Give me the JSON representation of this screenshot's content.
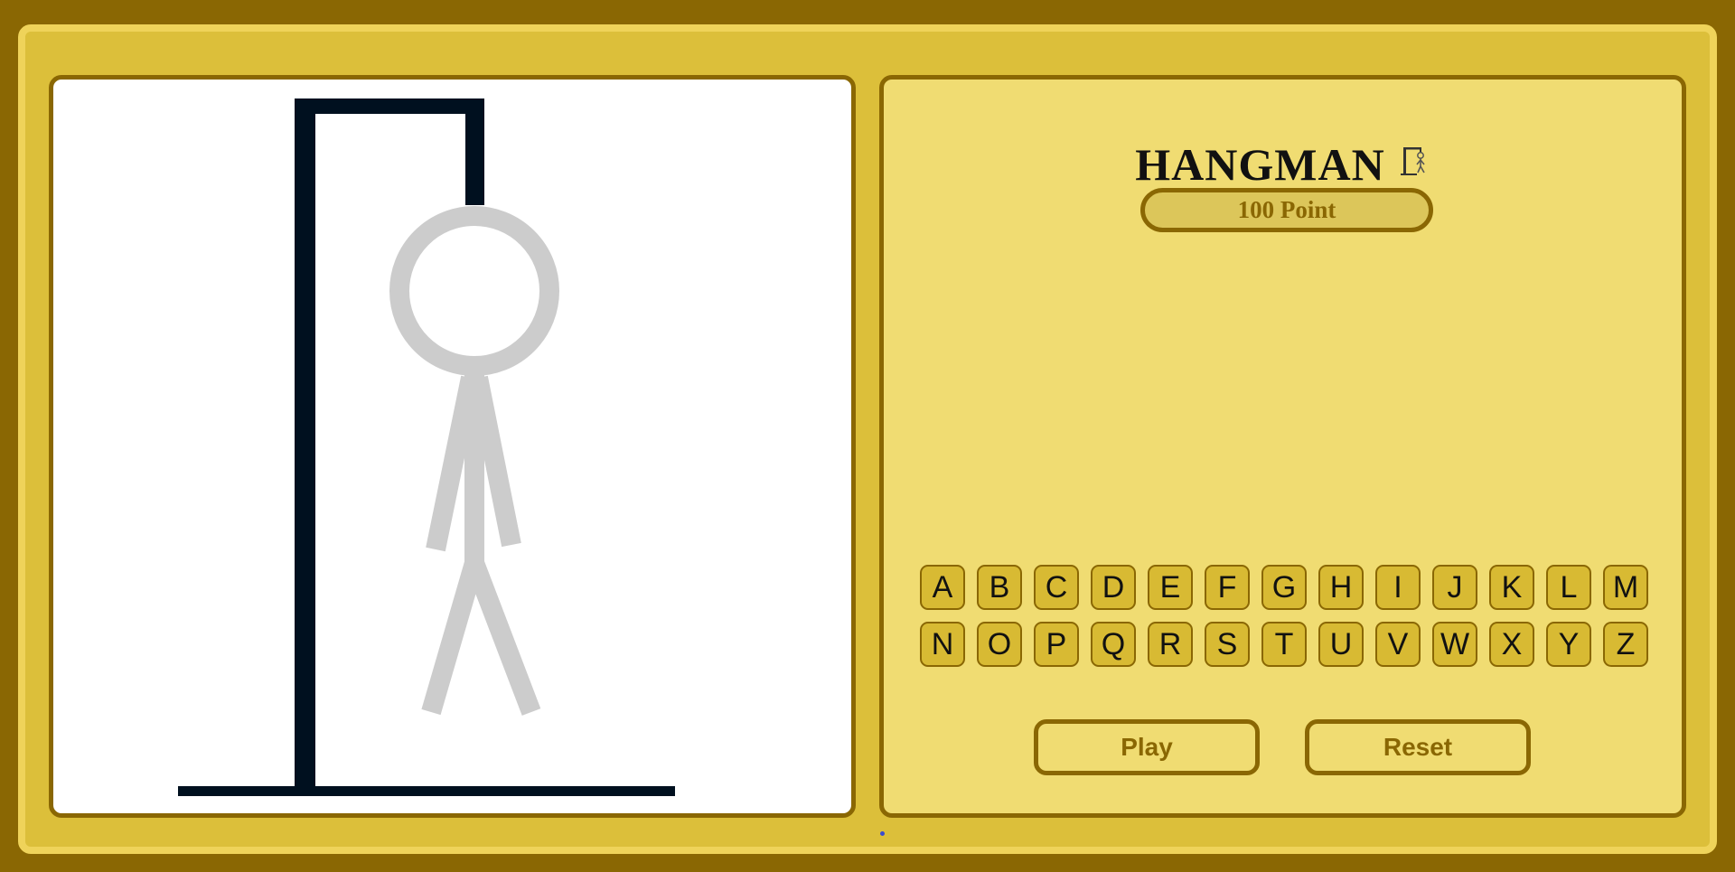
{
  "game": {
    "title": "HANGMAN",
    "score_label": "100 Point",
    "keyboard_rows": [
      [
        "A",
        "B",
        "C",
        "D",
        "E",
        "F",
        "G",
        "H",
        "I",
        "J",
        "K",
        "L",
        "M"
      ],
      [
        "N",
        "O",
        "P",
        "Q",
        "R",
        "S",
        "T",
        "U",
        "V",
        "W",
        "X",
        "Y",
        "Z"
      ]
    ],
    "play_label": "Play",
    "reset_label": "Reset",
    "wrong_guesses": 0,
    "max_wrong_guesses": 6
  },
  "colors": {
    "page_background": "#8a6703",
    "frame": "#dcbf3a",
    "panel": "#f0dc72",
    "border": "#8a6703",
    "gallows": "#00101f",
    "figure_unrevealed": "#cccccc",
    "key_fill": "#d8ba33"
  },
  "icons": {
    "title_icon": "hangman-icon"
  }
}
